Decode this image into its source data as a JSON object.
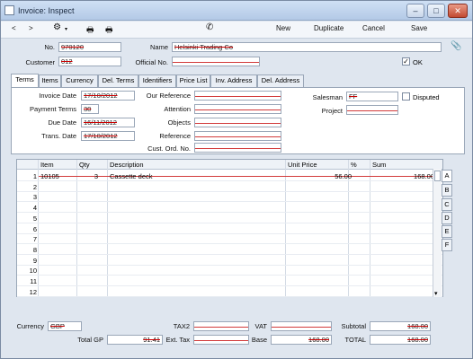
{
  "window": {
    "title": "Invoice: Inspect",
    "btn_min": "‒",
    "btn_max": "□",
    "btn_close": "✕"
  },
  "toolbar": {
    "prev": "<",
    "next": ">",
    "settings": "⚙",
    "print": "🖶",
    "preview": "🖶",
    "phone": "✆",
    "new": "New",
    "duplicate": "Duplicate",
    "cancel": "Cancel",
    "save": "Save"
  },
  "header": {
    "no_label": "No.",
    "no_value": "970120",
    "customer_label": "Customer",
    "customer_value": "012",
    "name_label": "Name",
    "name_value": "Helsinki Trading Co",
    "official_label": "Official No.",
    "official_value": "",
    "ok_label": "OK",
    "ok_checked": "✓"
  },
  "tabs": [
    "Terms",
    "Items",
    "Currency",
    "Del. Terms",
    "Identifiers",
    "Price List",
    "Inv. Address",
    "Del. Address"
  ],
  "terms": {
    "invoice_date_label": "Invoice Date",
    "invoice_date": "17/10/2012",
    "payment_terms_label": "Payment Terms",
    "payment_terms": "30",
    "due_date_label": "Due Date",
    "due_date": "16/11/2012",
    "trans_date_label": "Trans. Date",
    "trans_date": "17/10/2012",
    "our_ref_label": "Our Reference",
    "attention_label": "Attention",
    "objects_label": "Objects",
    "reference_label": "Reference",
    "cust_ord_label": "Cust. Ord. No.",
    "salesman_label": "Salesman",
    "salesman": "FF",
    "disputed_label": "Disputed",
    "project_label": "Project"
  },
  "grid": {
    "headers": [
      "Item",
      "Qty",
      "Description",
      "Unit Price",
      "%",
      "Sum"
    ],
    "rows": [
      {
        "n": "1",
        "item": "10105",
        "qty": "3",
        "desc": "Cassette deck",
        "price": "56.00",
        "pct": "",
        "sum": "168.00"
      },
      {
        "n": "2"
      },
      {
        "n": "3"
      },
      {
        "n": "4"
      },
      {
        "n": "5"
      },
      {
        "n": "6"
      },
      {
        "n": "7"
      },
      {
        "n": "8"
      },
      {
        "n": "9"
      },
      {
        "n": "10"
      },
      {
        "n": "11"
      },
      {
        "n": "12"
      }
    ],
    "side_tabs": [
      "A",
      "B",
      "C",
      "D",
      "E",
      "F"
    ],
    "scroll_down": "▾"
  },
  "footer": {
    "currency_label": "Currency",
    "currency": "GBP",
    "tax2_label": "TAX2",
    "vat_label": "VAT",
    "subtotal_label": "Subtotal",
    "subtotal": "168.00",
    "total_gp_label": "Total GP",
    "total_gp": "91.41",
    "ext_tax_label": "Ext. Tax",
    "base_label": "Base",
    "base": "168.00",
    "total_label": "TOTAL",
    "total": "168.00"
  }
}
